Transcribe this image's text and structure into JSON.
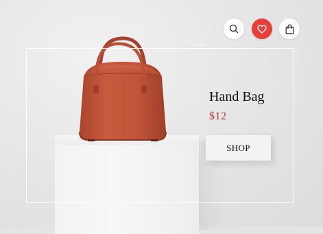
{
  "product": {
    "title": "Hand Bag",
    "price": "$12",
    "shop_label": "SHOP"
  },
  "actions": [
    {
      "icon": "search-icon"
    },
    {
      "icon": "heart-icon",
      "active": true
    },
    {
      "icon": "shopping-bag-icon"
    }
  ],
  "colors": {
    "accent": "#e5413a",
    "price": "#b0402e",
    "bag": "#c0553a",
    "background": "#e4e4e5"
  }
}
